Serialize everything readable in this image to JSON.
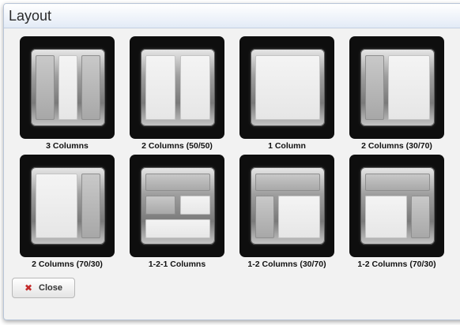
{
  "dialog": {
    "title": "Layout",
    "close_label": "Close",
    "close_icon": "close-x-icon"
  },
  "layouts": [
    {
      "id": "3col",
      "label": "3 Columns"
    },
    {
      "id": "2col5050",
      "label": "2 Columns (50/50)"
    },
    {
      "id": "1col",
      "label": "1 Column"
    },
    {
      "id": "2col3070",
      "label": "2 Columns (30/70)"
    },
    {
      "id": "2col7030",
      "label": "2 Columns (70/30)"
    },
    {
      "id": "121col",
      "label": "1-2-1 Columns"
    },
    {
      "id": "12col3070",
      "label": "1-2 Columns (30/70)"
    },
    {
      "id": "12col7030",
      "label": "1-2 Columns (70/30)"
    }
  ],
  "colors": {
    "title_bar": "#e3ebf6",
    "tile_bg": "#0e0e0e",
    "close_icon": "#c42a2a"
  }
}
